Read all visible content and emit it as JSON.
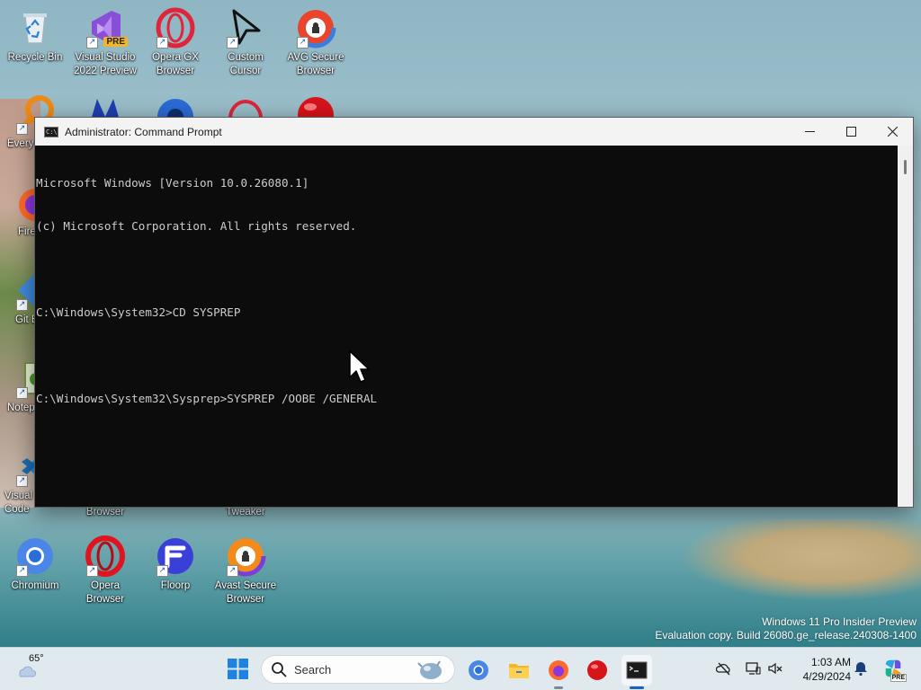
{
  "desktop": {
    "icons": [
      {
        "label": "Recycle Bin"
      },
      {
        "label": "Visual Studio 2022 Preview",
        "badge": "PRE"
      },
      {
        "label": "Opera GX Browser"
      },
      {
        "label": "Custom Cursor"
      },
      {
        "label": "AVG Secure Browser"
      },
      {
        "label": "Every"
      },
      {
        "label": "Fire"
      },
      {
        "label": "Git B"
      },
      {
        "label": "Notep"
      },
      {
        "label": "Visual Code"
      },
      {
        "label": "Browser"
      },
      {
        "label": "Tweaker"
      },
      {
        "label": "Chromium"
      },
      {
        "label": "Opera Browser"
      },
      {
        "label": "Floorp"
      },
      {
        "label": "Avast Secure Browser"
      }
    ]
  },
  "window": {
    "title": "Administrator: Command Prompt",
    "console_lines": [
      "Microsoft Windows [Version 10.0.26080.1]",
      "(c) Microsoft Corporation. All rights reserved.",
      "",
      "C:\\Windows\\System32>CD SYSPREP",
      "",
      "C:\\Windows\\System32\\Sysprep>SYSPREP /OOBE /GENERAL"
    ]
  },
  "watermark": {
    "line1": "Windows 11 Pro Insider Preview",
    "line2": "Evaluation copy. Build 26080.ge_release.240308-1400"
  },
  "taskbar": {
    "weather_temp": "65°",
    "search_placeholder": "Search",
    "clock_time": "1:03 AM",
    "clock_date": "4/29/2024",
    "copilot_badge": "PRE"
  },
  "colors": {
    "console_bg": "#0c0c0c",
    "console_text": "#cccccc",
    "taskbar_bg": "#dfe9ee",
    "accent": "#1565c0"
  }
}
